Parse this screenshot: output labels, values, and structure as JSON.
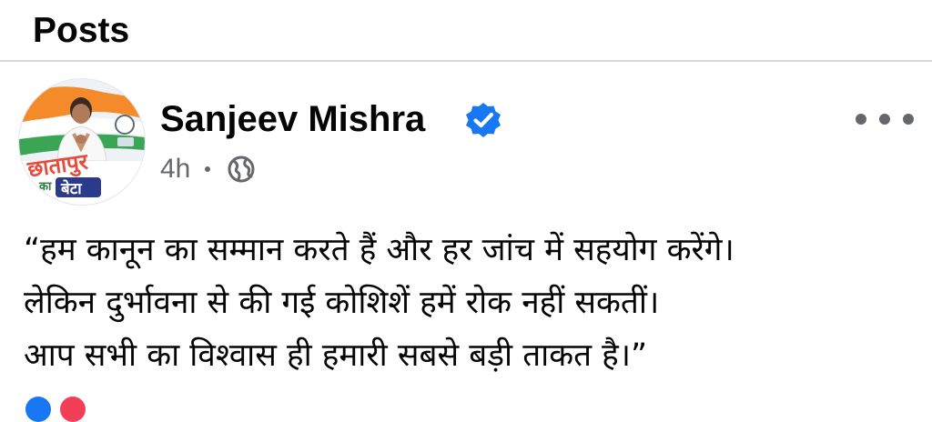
{
  "section": {
    "title": "Posts"
  },
  "post": {
    "author": {
      "name": "Sanjeev Mishra",
      "verified": true,
      "avatar_text_top": "छातापुर",
      "avatar_text_mid": "का",
      "avatar_text_bottom": "बेटा"
    },
    "meta": {
      "time": "4h",
      "audience_icon": "globe-icon"
    },
    "more_icon": "more-horizontal-icon",
    "body_lines": [
      "“हम कानून का सम्मान करते हैं और हर जांच में सहयोग करेंगे।",
      "लेकिन दुर्भावना से की गई कोशिशें हमें रोक नहीं सकतीं।",
      "आप सभी का विश्वास ही हमारी सबसे बड़ी ताकत है।”"
    ]
  },
  "colors": {
    "text_primary": "#050505",
    "text_secondary": "#65676b",
    "verified_blue": "#1877f2",
    "divider": "#d7d9dc"
  }
}
